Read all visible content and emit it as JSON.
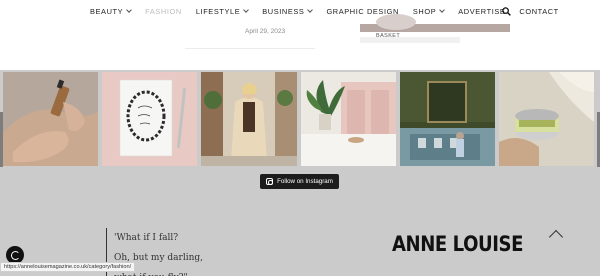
{
  "nav": {
    "items": [
      {
        "label": "BEAUTY",
        "has_dropdown": true,
        "active": false
      },
      {
        "label": "FASHION",
        "has_dropdown": false,
        "active": true
      },
      {
        "label": "LIFESTYLE",
        "has_dropdown": true,
        "active": false
      },
      {
        "label": "BUSINESS",
        "has_dropdown": true,
        "active": false
      },
      {
        "label": "GRAPHIC DESIGN",
        "has_dropdown": false,
        "active": false
      },
      {
        "label": "SHOP",
        "has_dropdown": true,
        "active": false
      },
      {
        "label": "ADVERTISE",
        "has_dropdown": false,
        "active": false
      },
      {
        "label": "CONTACT",
        "has_dropdown": false,
        "active": false
      }
    ],
    "search_icon": "search-icon"
  },
  "post": {
    "date": "April 29, 2023"
  },
  "sidebar": {
    "basket_label": "BASKET"
  },
  "instagram": {
    "follow_label": "Follow on Instagram",
    "tiles": [
      {
        "name": "hands-serum"
      },
      {
        "name": "card-pen"
      },
      {
        "name": "woman-coat"
      },
      {
        "name": "kitchen-plant"
      },
      {
        "name": "green-room"
      },
      {
        "name": "cream-jar"
      }
    ]
  },
  "footer": {
    "quote_lines": [
      "'What if I fall?",
      "Oh, but my darling,",
      "what if you fly?\""
    ],
    "brand": "ANNE LOUISE"
  },
  "status_bar": {
    "url": "https://annelouisemagazine.co.uk/category/fashion/"
  },
  "colors": {
    "overlay": "#cbcbcb",
    "button": "#1c1c1c"
  }
}
